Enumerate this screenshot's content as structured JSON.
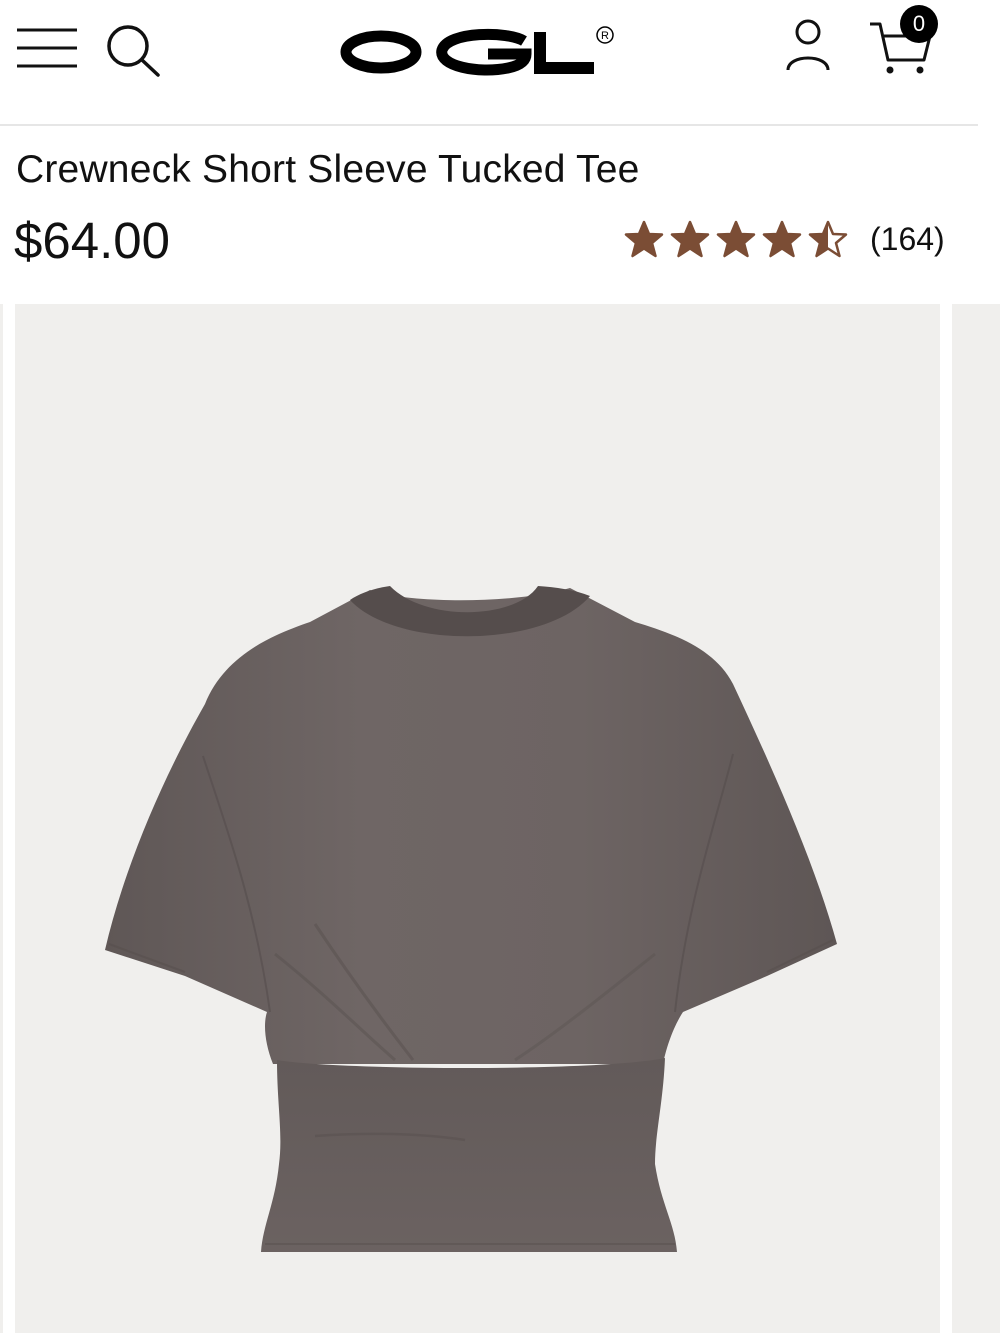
{
  "header": {
    "logo_text": "OGL",
    "logo_mark": "®",
    "cart_count": "0",
    "icons": [
      "menu-icon",
      "search-icon",
      "account-icon",
      "cart-icon"
    ]
  },
  "product": {
    "title": "Crewneck Short Sleeve Tucked Tee",
    "price": "$64.00",
    "rating": 4.5,
    "rating_max": 5,
    "review_count": "(164)",
    "image_alt": "Crewneck Short Sleeve Tucked Tee in taupe gray"
  },
  "colors": {
    "star": "#7b4d35",
    "garment": "#6c6362",
    "image_background": "#f0efed",
    "badge": "#000000"
  }
}
